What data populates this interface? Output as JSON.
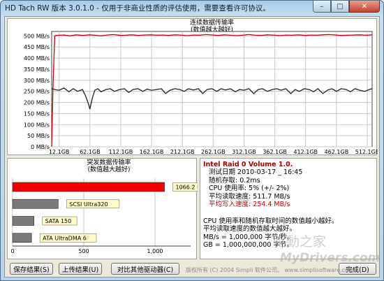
{
  "window": {
    "title": "HD Tach RW 版本 3.0.1.0 - 仅用于非商业性质的评估使用，需要查看许可协议。",
    "min_glyph": "–",
    "max_glyph": "□",
    "close_glyph": "✕"
  },
  "chart_data": [
    {
      "type": "line",
      "title": "连续数据传输率\n(数值越大越好)",
      "y_tick_labels": [
        "500 MB/s",
        "450 MB/s",
        "400 MB/s",
        "350 MB/s",
        "300 MB/s",
        "250 MB/s",
        "200 MB/s",
        "150 MB/s",
        "100 MB/s",
        "50 MB/s",
        "0 MB/s"
      ],
      "x_tick_labels": [
        "12.1GB",
        "62.1GB",
        "112.1GB",
        "162.1GB",
        "212.1GB",
        "262.1GB",
        "312.1GB",
        "362.1GB",
        "412.1GB",
        "462.1GB",
        "512.1GB"
      ],
      "ylim": [
        0,
        520
      ],
      "xlim": [
        0,
        520
      ],
      "grid": true,
      "series": [
        {
          "color": "#cc0000",
          "x": [
            0,
            2,
            5,
            8,
            12,
            20,
            30,
            40,
            50,
            62,
            70,
            80,
            90,
            100,
            112,
            120,
            130,
            140,
            150,
            162,
            170,
            180,
            190,
            200,
            212,
            220,
            230,
            240,
            250,
            262,
            270,
            280,
            290,
            300,
            312,
            320,
            330,
            340,
            350,
            362,
            370,
            380,
            390,
            400,
            412,
            420,
            430,
            440,
            450,
            462,
            470,
            480,
            490,
            500,
            512,
            520
          ],
          "values": [
            0,
            260,
            500,
            502,
            503,
            504,
            500,
            505,
            502,
            505,
            503,
            500,
            504,
            506,
            502,
            503,
            505,
            502,
            504,
            505,
            503,
            504,
            502,
            505,
            503,
            501,
            504,
            503,
            506,
            504,
            502,
            505,
            503,
            501,
            504,
            506,
            503,
            502,
            505,
            503,
            501,
            504,
            503,
            505,
            502,
            504,
            503,
            505,
            506,
            504,
            502,
            503,
            504,
            505,
            503,
            505
          ]
        },
        {
          "color": "#202020",
          "x": [
            0,
            5,
            12,
            20,
            28,
            35,
            42,
            50,
            55,
            60,
            62,
            66,
            70,
            75,
            80,
            88,
            95,
            102,
            110,
            118,
            125,
            132,
            140,
            148,
            155,
            162,
            170,
            178,
            185,
            192,
            200,
            208,
            215,
            222,
            230,
            238,
            245,
            252,
            260,
            268,
            275,
            282,
            290,
            298,
            305,
            312,
            320,
            328,
            335,
            342,
            350,
            358,
            365,
            372,
            380,
            388,
            395,
            402,
            410,
            418,
            425,
            432,
            440,
            448,
            455,
            462,
            470,
            478,
            485,
            492,
            500,
            508,
            515,
            520
          ],
          "values": [
            262,
            258,
            255,
            265,
            248,
            262,
            250,
            258,
            230,
            190,
            170,
            220,
            255,
            262,
            248,
            258,
            262,
            250,
            258,
            262,
            245,
            258,
            262,
            250,
            260,
            255,
            258,
            262,
            240,
            255,
            262,
            258,
            250,
            262,
            256,
            262,
            240,
            258,
            262,
            250,
            262,
            256,
            262,
            248,
            258,
            255,
            262,
            240,
            258,
            262,
            250,
            258,
            262,
            255,
            262,
            240,
            258,
            250,
            262,
            258,
            248,
            262,
            240,
            256,
            262,
            250,
            262,
            258,
            248,
            262,
            255,
            250,
            258,
            262
          ]
        }
      ]
    },
    {
      "type": "bar",
      "title": "突发数据传输率\n(数值越大越好)",
      "x_tick_labels": [
        "0",
        "500",
        "1,000"
      ],
      "xlim": [
        0,
        1250
      ],
      "categories": [
        "1066.2 MB/s",
        "SCSI Ultra320",
        "SATA 150",
        "ATA UltraDMA 6"
      ],
      "values": [
        1066.2,
        320,
        150,
        133
      ],
      "colors": [
        "#ee0000",
        "#7a7a7a",
        "#7a7a7a",
        "#7a7a7a"
      ]
    }
  ],
  "info": {
    "title": "Intel Raid 0 Volume 1.0.",
    "test_date": "测试日期 2010-03-17 _ 16:45",
    "random_access": "随机存取: 0.2ms",
    "cpu_usage": "CPU 使用率: 5% (+/- 2%)",
    "avg_read": "平均读取速度: 511.7 MB/s",
    "avg_write": "平均写入速度: 254.4 MB/s",
    "note1": "CPU 使用率和随机存取时间的数值越小越好。",
    "note2": "平均读取速度的数值越大越好。",
    "note3": "MB/s = 1,000,000 字节/秒。",
    "note4": "GB = 1,000,000,000 字节。"
  },
  "buttons": {
    "save": "保存结果(S)",
    "upload": "上传结果(U)",
    "compare": "对比其他驱动器(C)",
    "done": "完成(D)"
  },
  "footer": {
    "copyright": "版权所有 (C) 2004 Simpli 软件公司。 www.simplisoftware.com"
  },
  "watermark": {
    "line1": "驱動之家",
    "line2": "MyDrivers.com"
  }
}
